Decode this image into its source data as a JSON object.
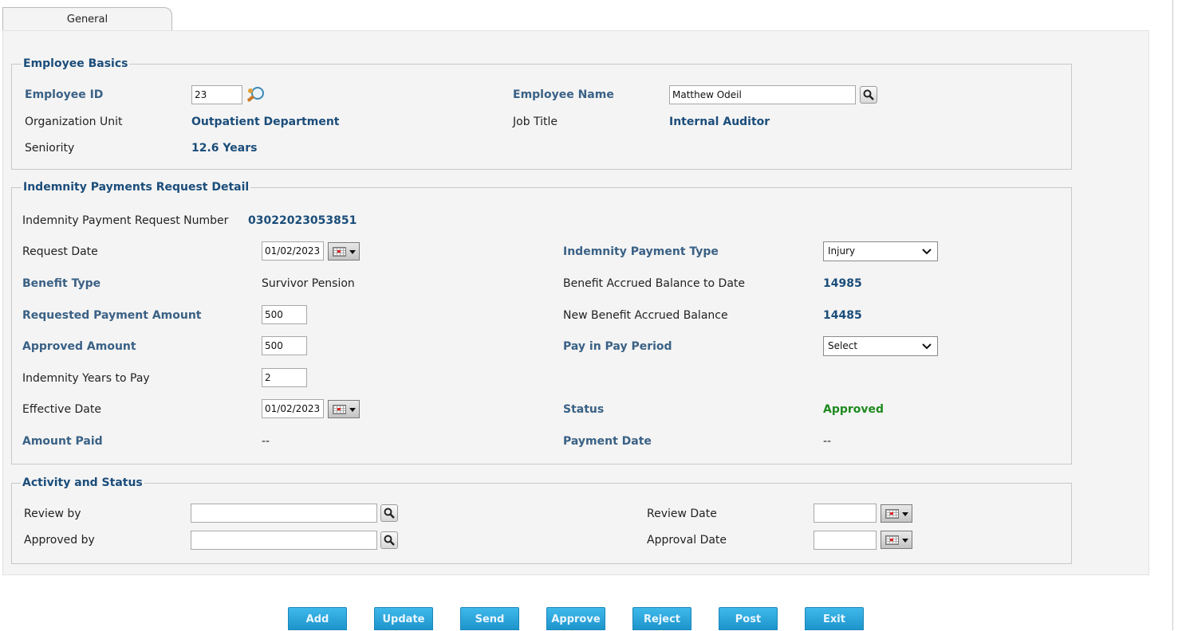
{
  "tab": {
    "label": "General"
  },
  "employee_basics": {
    "title": "Employee Basics",
    "employee_id_label": "Employee ID",
    "employee_id_value": "23",
    "employee_name_label": "Employee Name",
    "employee_name_value": "Matthew Odeil",
    "org_unit_label": "Organization Unit",
    "org_unit_value": "Outpatient Department",
    "job_title_label": "Job Title",
    "job_title_value": "Internal Auditor",
    "seniority_label": "Seniority",
    "seniority_value": "12.6 Years"
  },
  "request_detail": {
    "title": "Indemnity Payments Request Detail",
    "request_number_label": "Indemnity Payment Request Number",
    "request_number_value": "03022023053851",
    "request_date_label": "Request Date",
    "request_date_value": "01/02/2023",
    "payment_type_label": "Indemnity Payment Type",
    "payment_type_value": "Injury",
    "benefit_type_label": "Benefit Type",
    "benefit_type_value": "Survivor Pension",
    "accrued_balance_label": "Benefit Accrued Balance to Date",
    "accrued_balance_value": "14985",
    "requested_amount_label": "Requested Payment Amount",
    "requested_amount_value": "500",
    "new_balance_label": "New Benefit Accrued Balance",
    "new_balance_value": "14485",
    "approved_amount_label": "Approved Amount",
    "approved_amount_value": "500",
    "pay_period_label": "Pay in Pay Period",
    "pay_period_value": "Select",
    "years_to_pay_label": "Indemnity Years to Pay",
    "years_to_pay_value": "2",
    "effective_date_label": "Effective Date",
    "effective_date_value": "01/02/2023",
    "status_label": "Status",
    "status_value": "Approved",
    "amount_paid_label": "Amount Paid",
    "amount_paid_value": "--",
    "payment_date_label": "Payment Date",
    "payment_date_value": "--"
  },
  "activity": {
    "title": "Activity and Status",
    "review_by_label": "Review by",
    "review_by_value": "",
    "approved_by_label": "Approved by",
    "approved_by_value": "",
    "review_date_label": "Review Date",
    "review_date_value": "",
    "approval_date_label": "Approval Date",
    "approval_date_value": ""
  },
  "buttons": {
    "add": "Add",
    "update": "Update",
    "send": "Send",
    "approve": "Approve",
    "reject": "Reject",
    "post": "Post",
    "exit": "Exit"
  },
  "icons": {
    "employee_lookup": "magnifier-person-icon",
    "search": "search-icon",
    "calendar": "calendar-icon"
  },
  "colors": {
    "label_blue": "#3a6185",
    "value_blue": "#1b4d7a",
    "status_green": "#1f8a1f",
    "button_blue": "#2aa6dc"
  }
}
